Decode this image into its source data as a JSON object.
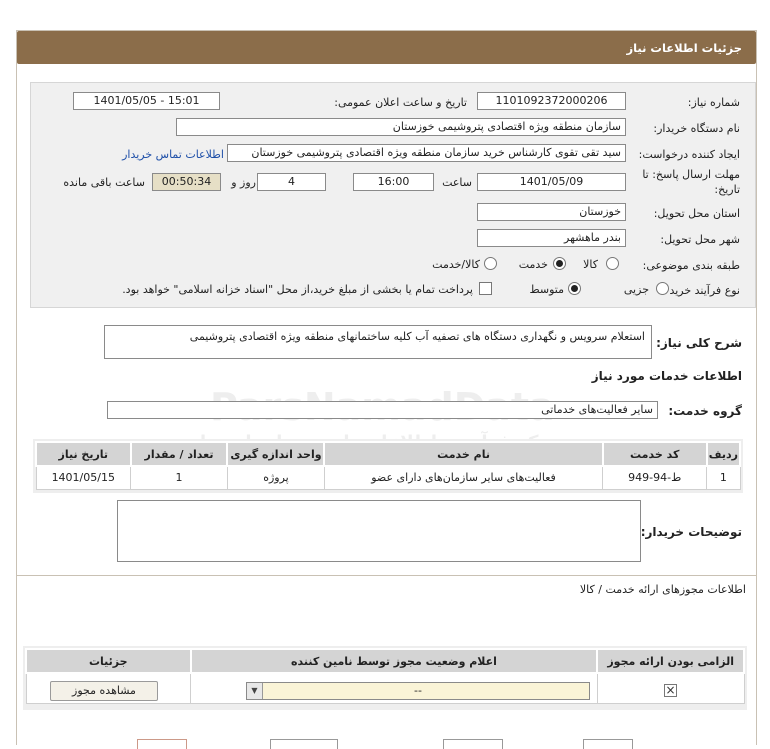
{
  "title": "جزئیات اطلاعات نیاز",
  "fields": {
    "need_number_label": "شماره نیاز:",
    "need_number": "1101092372000206",
    "announce_label": "تاریخ و ساعت اعلان عمومی:",
    "announce_value": "1401/05/05 - 15:01",
    "buyer_org_label": "نام دستگاه خریدار:",
    "buyer_org": "سازمان منطقه ویژه اقتصادی پتروشیمی خوزستان",
    "requester_label": "ایجاد کننده درخواست:",
    "requester": "سید تقی تقوی کارشناس خرید سازمان منطقه ویژه اقتصادی پتروشیمی خوزستان",
    "contact_link": "اطلاعات تماس خریدار",
    "deadline_label": "مهلت ارسال پاسخ: تا",
    "deadline_label2": "تاریخ:",
    "deadline_date": "1401/05/09",
    "time_label": "ساعت",
    "deadline_time": "16:00",
    "days": "4",
    "days_label": "روز و",
    "remaining": "00:50:34",
    "remaining_label": "ساعت باقی مانده",
    "province_label": "استان محل تحویل:",
    "province": "خوزستان",
    "city_label": "شهر محل تحویل:",
    "city": "بندر ماهشهر",
    "category_label": "طبقه بندی موضوعی:",
    "category_options": [
      "کالا",
      "خدمت",
      "کالا/خدمت"
    ],
    "category_selected": "خدمت",
    "process_label": "نوع فرآیند خرید :",
    "process_options": [
      "جزیی",
      "متوسط"
    ],
    "process_selected": "متوسط",
    "payment_note": "پرداخت تمام یا بخشی از مبلغ خرید،از محل \"اسناد خزانه اسلامی\" خواهد بود."
  },
  "summary": {
    "label": "شرح کلی نیاز:",
    "text": "استعلام سرویس و نگهداری دستگاه های تصفیه آب کلیه ساختمانهای منطقه ویژه اقتصادی پتروشیمی"
  },
  "services": {
    "heading": "اطلاعات خدمات مورد نیاز",
    "group_label": "گروه خدمت:",
    "group_value": "سایر فعالیت‌های خدماتی",
    "columns": [
      "ردیف",
      "کد خدمت",
      "نام خدمت",
      "واحد اندازه گیری",
      "تعداد / مقدار",
      "تاریخ نیاز"
    ],
    "rows": [
      [
        "1",
        "ط-94-949",
        "فعالیت‌های سایر سازمان‌های دارای عضو",
        "پروژه",
        "1",
        "1401/05/15"
      ]
    ]
  },
  "buyer_notes_label": "توضیحات خریدار:",
  "licenses": {
    "heading": "اطلاعات مجوزهای ارائه خدمت / کالا",
    "columns": [
      "الزامی بودن ارائه مجوز",
      "اعلام وضعیت مجوز توسط نامین کننده",
      "جزئیات"
    ],
    "select_value": "--",
    "view_button": "مشاهده مجوز"
  },
  "watermark": {
    "brand": "ParsNamadData",
    "line1": "مرکز فرآوری اطلاعات پارس نماد داده ها",
    "line2": "پایگاه اطلاع رسانی مناقصه ومزایده",
    "phone": "۰۲۱-۸۸۳۴۹۶۷۰-۵"
  }
}
